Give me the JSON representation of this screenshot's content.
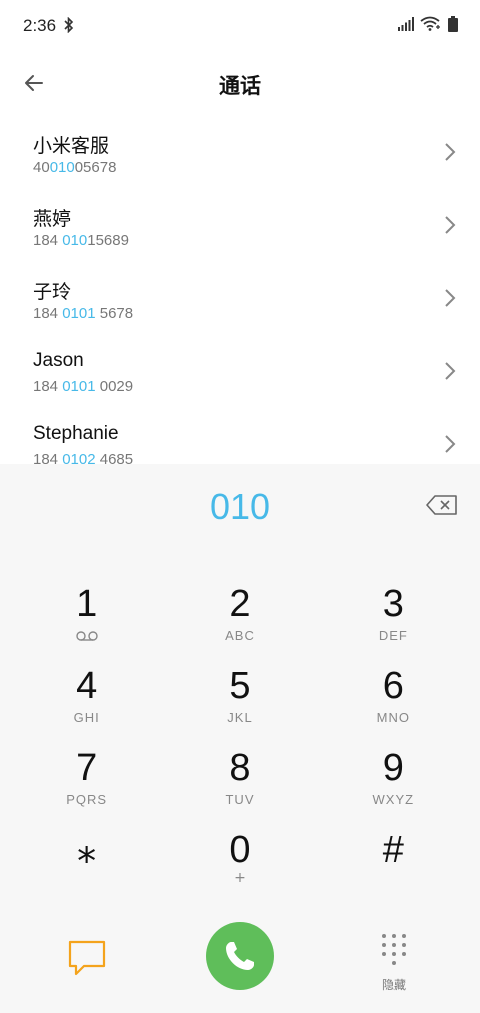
{
  "status": {
    "time": "2:36"
  },
  "header": {
    "title": "通话"
  },
  "contacts": [
    {
      "name": "小米客服",
      "num_pre": "40",
      "num_hl": "010",
      "num_post": "05678"
    },
    {
      "name": "燕婷",
      "num_pre": "184 ",
      "num_hl": "010",
      "num_post": "15689"
    },
    {
      "name": "子玲",
      "num_pre": "184 ",
      "num_hl": "0101",
      "num_post": " 5678"
    },
    {
      "name": "Jason",
      "num_pre": "184 ",
      "num_hl": "0101",
      "num_post": " 0029"
    },
    {
      "name": "Stephanie",
      "num_pre": "184 ",
      "num_hl": "0102",
      "num_post": " 4685"
    }
  ],
  "dialpad": {
    "display": "010",
    "keys": [
      {
        "digit": "1",
        "letters": ""
      },
      {
        "digit": "2",
        "letters": "ABC"
      },
      {
        "digit": "3",
        "letters": "DEF"
      },
      {
        "digit": "4",
        "letters": "GHI"
      },
      {
        "digit": "5",
        "letters": "JKL"
      },
      {
        "digit": "6",
        "letters": "MNO"
      },
      {
        "digit": "7",
        "letters": "PQRS"
      },
      {
        "digit": "8",
        "letters": "TUV"
      },
      {
        "digit": "9",
        "letters": "WXYZ"
      },
      {
        "digit": "⁎",
        "letters": ""
      },
      {
        "digit": "0",
        "letters": "+"
      },
      {
        "digit": "#",
        "letters": ""
      }
    ],
    "hide_label": "隐藏"
  },
  "colors": {
    "accent": "#47b9e8",
    "call": "#5fbe5a",
    "message": "#f4a31c"
  }
}
